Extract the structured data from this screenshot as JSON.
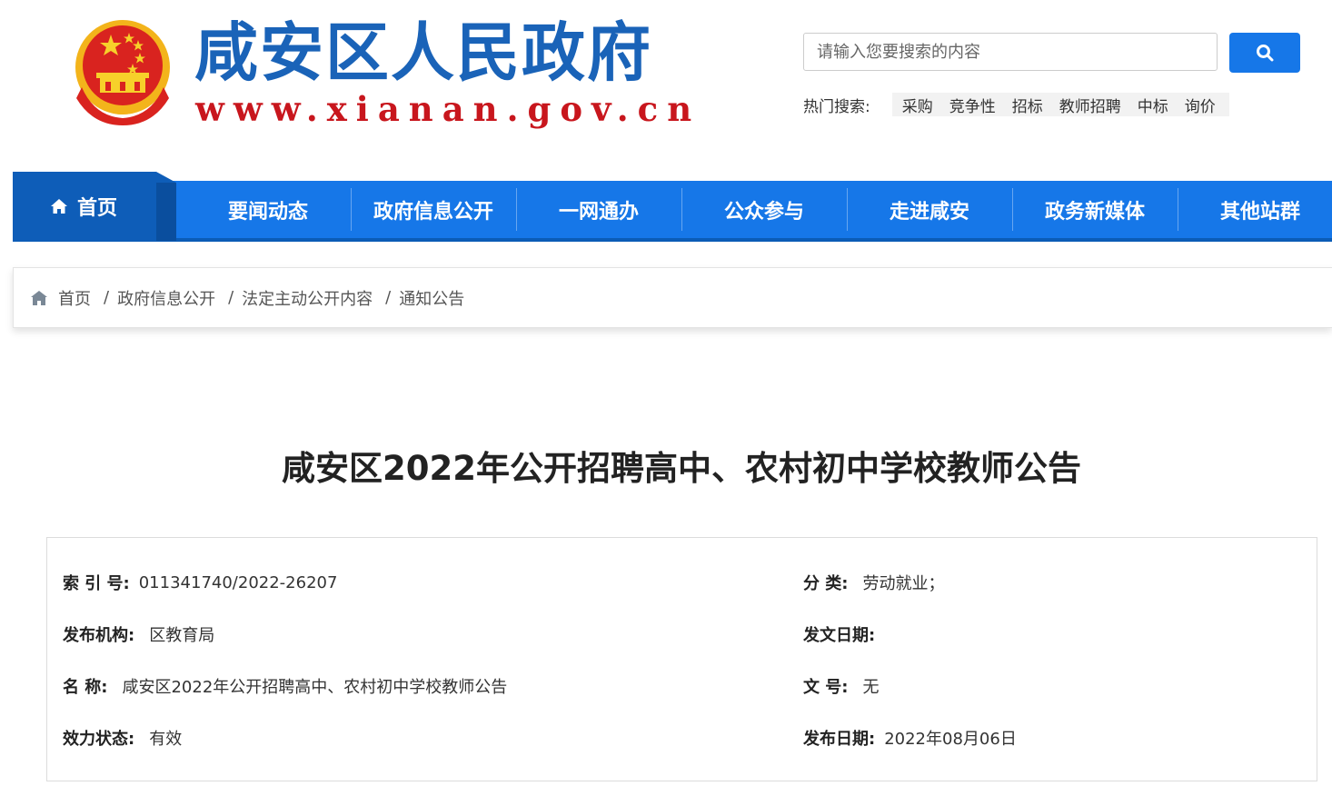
{
  "header": {
    "site_title": "咸安区人民政府",
    "site_url": "www.xianan.gov.cn",
    "search_placeholder": "请输入您要搜索的内容",
    "hot_search_label": "热门搜索:",
    "hot_search_items": [
      "采购",
      "竞争性",
      "招标",
      "教师招聘",
      "中标",
      "询价"
    ]
  },
  "nav": {
    "home_label": "首页",
    "items": [
      "要闻动态",
      "政府信息公开",
      "一网通办",
      "公众参与",
      "走进咸安",
      "政务新媒体",
      "其他站群"
    ]
  },
  "breadcrumb": [
    "首页",
    "政府信息公开",
    "法定主动公开内容",
    "通知公告"
  ],
  "article": {
    "title": "咸安区2022年公开招聘高中、农村初中学校教师公告",
    "meta": {
      "index_label": "索 引 号:",
      "index_value": "011341740/2022-26207",
      "category_label": "分 类:",
      "category_value": "劳动就业；",
      "publisher_label": "发布机构:",
      "publisher_value": "区教育局",
      "issue_date_label": "发文日期:",
      "issue_date_value": "",
      "name_label": "名 称:",
      "name_value": "咸安区2022年公开招聘高中、农村初中学校教师公告",
      "doc_no_label": "文 号:",
      "doc_no_value": "无",
      "status_label": "效力状态:",
      "status_value": "有效",
      "publish_date_label": "发布日期:",
      "publish_date_value": "2022年08月06日"
    }
  },
  "colors": {
    "primary_blue": "#1677e8",
    "dark_blue": "#0e5db8",
    "title_blue": "#1a63b8",
    "url_red": "#c8161d"
  },
  "icons": {
    "emblem": "national-emblem-icon",
    "search": "search-icon",
    "home": "home-icon",
    "breadcrumb_home": "house-icon"
  }
}
